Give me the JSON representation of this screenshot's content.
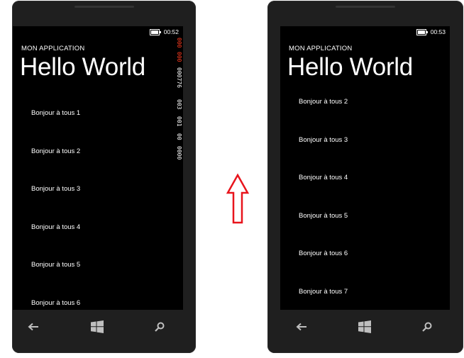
{
  "left_phone": {
    "status": {
      "time": "00:52"
    },
    "app_title": "MON APPLICATION",
    "page_title": "Hello World",
    "items": [
      "Bonjour à tous 1",
      "Bonjour à tous 2",
      "Bonjour à tous 3",
      "Bonjour à tous 4",
      "Bonjour à tous 5",
      "Bonjour à tous 6"
    ],
    "perf_counters": [
      "000",
      "000",
      "000776",
      "003",
      "001",
      "00",
      "0000"
    ]
  },
  "right_phone": {
    "status": {
      "time": "00:53"
    },
    "app_title": "MON APPLICATION",
    "page_title": "Hello World",
    "items": [
      "Bonjour à tous 2",
      "Bonjour à tous 3",
      "Bonjour à tous 4",
      "Bonjour à tous 5",
      "Bonjour à tous 6",
      "Bonjour à tous 7"
    ]
  },
  "navbar": {
    "icons": [
      "back-arrow-icon",
      "windows-logo-icon",
      "search-icon"
    ],
    "icon_color": "#bfbfbf"
  },
  "arrow": {
    "direction": "up",
    "color": "#e8141c"
  }
}
